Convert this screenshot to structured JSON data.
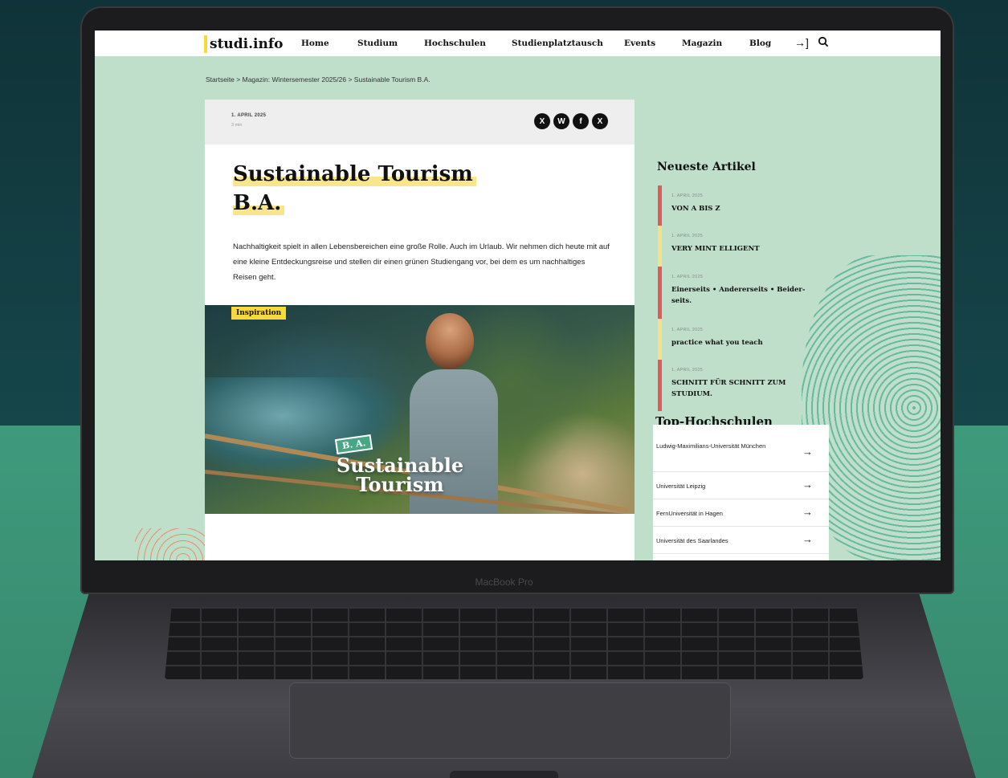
{
  "device": {
    "label": "MacBook Pro"
  },
  "site": {
    "logo": "studi.info",
    "nav": [
      "Home",
      "Studium",
      "Hochschulen",
      "Studienplatztausch",
      "Events",
      "Magazin",
      "Blog"
    ],
    "login_icon": "login-arrow-icon",
    "search_icon": "search-icon"
  },
  "breadcrumb": {
    "home": "Startseite",
    "sep1": ">",
    "section": "Magazin: Wintersemester 2025/26",
    "sep2": ">",
    "current": "Sustainable Tourism B.A."
  },
  "article": {
    "date": "1. APRIL 2025",
    "read_time": "3 min",
    "share_icons": [
      "x-icon",
      "whatsapp-icon",
      "facebook-icon",
      "xing-icon"
    ],
    "share_glyphs": [
      "X",
      "W",
      "f",
      "X"
    ],
    "title_line1": "Sustainable Tourism",
    "title_line2": "B.A.",
    "lead": "Nachhaltigkeit spielt in allen Lebensbereichen eine große Rolle. Auch im Urlaub. Wir nehmen dich heute mit auf eine kleine Entdeckungsreise und stellen dir einen grünen Studiengang vor, bei dem es um nachhaltiges Reisen geht.",
    "category_tag": "Inspiration",
    "hero_badge": "B. A.",
    "hero_title_line1": "Sustainable",
    "hero_title_line2": "Tourism"
  },
  "sidebar": {
    "latest_heading": "Neueste Artikel",
    "latest": [
      {
        "date": "1. APRIL 2025",
        "title": "VON A BIS Z",
        "bar_color": "#e05a5a"
      },
      {
        "date": "1. APRIL 2025",
        "title": "VERY MINT ELLIGENT",
        "bar_color": "#f3e28a"
      },
      {
        "date": "1. APRIL 2025",
        "title": "Einerseits • Andererseits • Beider-seits.",
        "bar_color": "#e05a5a"
      },
      {
        "date": "1. APRIL 2025",
        "title": "practice what you teach",
        "bar_color": "#f3e28a"
      },
      {
        "date": "1. APRIL 2025",
        "title": "SCHNITT FÜR SCHNITT ZUM STUDIUM.",
        "bar_color": "#e05a5a"
      }
    ],
    "top_heading": "Top-Hochschulen",
    "top_unis": [
      {
        "name": "Ludwig-Maximilians-Universität München",
        "arrow": "→"
      },
      {
        "name": "Universität Leipzig",
        "arrow": "→"
      },
      {
        "name": "FernUniversität in Hagen",
        "arrow": "→"
      },
      {
        "name": "Universität des Saarlandes",
        "arrow": "→"
      }
    ]
  },
  "colors": {
    "accent_yellow": "#f7d93b",
    "page_bg": "#bfdfcb",
    "badge_green": "#4aa585",
    "bar_red": "#e05a5a"
  }
}
